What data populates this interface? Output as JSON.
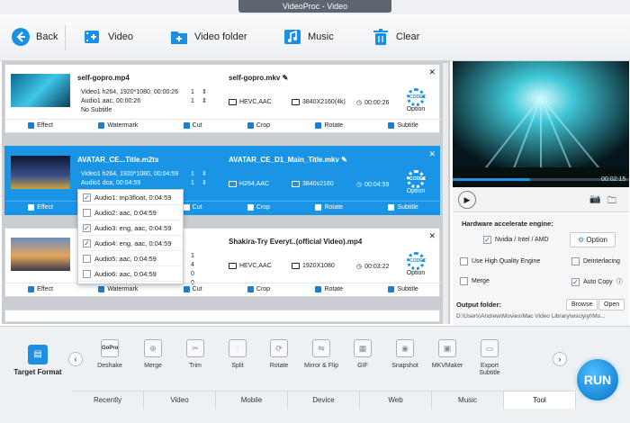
{
  "window": {
    "title": "VideoProc - Video"
  },
  "toolbar": {
    "back": "Back",
    "video": "Video",
    "video_folder": "Video folder",
    "music": "Music",
    "clear": "Clear"
  },
  "items": [
    {
      "src_name": "self-gopro.mp4",
      "video_info": "Video1  h264, 1920*1080, 00:00:26",
      "audio_info": "Audio1  aac, 00:00:26",
      "subtitle": "No Subtitle",
      "out_name": "self-gopro.mkv",
      "codec": "HEVC,AAC",
      "resolution": "3840X2160(4k)",
      "duration": "00:00:26",
      "option": "Option"
    },
    {
      "src_name": "AVATAR_CE...Title.m2ts",
      "video_info": "Video1  h264, 1920*1080, 00:04:59",
      "audio_info": "Audio1  dca, 00:04:59",
      "out_name": "AVATAR_CE_D1_Main_Title.mkv",
      "codec": "H264,AAC",
      "resolution": "3840x2160",
      "duration": "00:04:59",
      "option": "Option"
    },
    {
      "src_name": "Shakira-Try Everyt..(official Video).mp4",
      "codec": "HEVC,AAC",
      "resolution": "1920X1080",
      "duration": "00:03:22",
      "option": "Option"
    }
  ],
  "counts": {
    "r1a": "1",
    "r1b": "1",
    "r2a": "1",
    "r2b": "1",
    "r3a": "1",
    "r3b": "4",
    "r3c": "0",
    "r3d": "0"
  },
  "edit_bar": {
    "effect": "Effect",
    "watermark": "Watermark",
    "cut": "Cut",
    "crop": "Crop",
    "rotate": "Rotate",
    "subtitle": "Subtitle"
  },
  "audio_dropdown": [
    {
      "label": "Audio1: mp3float, 0:04:59",
      "checked": true
    },
    {
      "label": "Audio2: aac, 0:04:59",
      "checked": false
    },
    {
      "label": "Audio3: eng, aac, 0:04:59",
      "checked": true
    },
    {
      "label": "Audio4: eng, aac, 0:04:59",
      "checked": true
    },
    {
      "label": "Audio5: aac, 0:04:59",
      "checked": false
    },
    {
      "label": "Audio6: aac, 0:04:59",
      "checked": false
    }
  ],
  "preview": {
    "time": "00:02:15"
  },
  "settings": {
    "hw_title": "Hardware accelerate engine:",
    "hw_option": "Nvidia / Intel / AMD",
    "option_btn": "Option",
    "hq": "Use High Quality Engine",
    "deinterlacing": "Deinterlacing",
    "merge": "Merge",
    "autocopy": "Auto Copy",
    "output_label": "Output folder:",
    "browse": "Browse",
    "open": "Open",
    "output_path": "D:\\Users\\Andrew\\Movies\\Mac Video Library\\wsciyiyi\\Mo..."
  },
  "bottom": {
    "target_format": "Target Format",
    "tools": [
      "Deshake",
      "Merge",
      "Trim",
      "Split",
      "Rotate",
      "Mirror & Flip",
      "GIF",
      "Snapshot",
      "MKVMaker",
      "Export Subtitle"
    ],
    "gopro_label": "GoPro",
    "tabs": [
      "Recently",
      "Video",
      "Mobile",
      "Device",
      "Web",
      "Music",
      "Tool"
    ],
    "run": "RUN"
  }
}
